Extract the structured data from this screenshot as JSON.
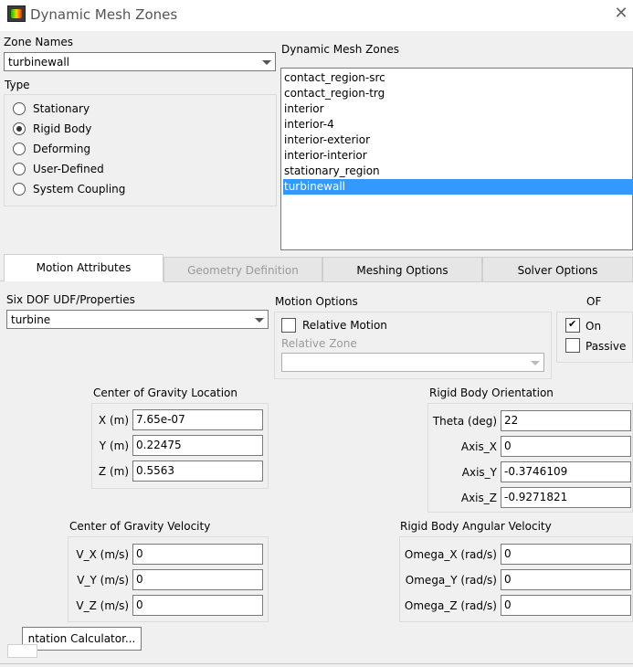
{
  "window": {
    "title": "Dynamic Mesh Zones"
  },
  "zone_names": {
    "label": "Zone Names",
    "value": "turbinewall"
  },
  "type": {
    "label": "Type",
    "options": [
      "Stationary",
      "Rigid Body",
      "Deforming",
      "User-Defined",
      "System Coupling"
    ],
    "selected": "Rigid Body"
  },
  "zones_list": {
    "label": "Dynamic Mesh Zones",
    "items": [
      "contact_region-src",
      "contact_region-trg",
      "interior",
      "interior-4",
      "interior-exterior",
      "interior-interior",
      "stationary_region",
      "turbinewall"
    ],
    "selected": "turbinewall"
  },
  "tabs": [
    "Motion Attributes",
    "Geometry Definition",
    "Meshing Options",
    "Solver Options"
  ],
  "six_dof": {
    "label": "Six DOF UDF/Properties",
    "value": "turbine"
  },
  "motion_options": {
    "label": "Motion Options",
    "relative_motion": "Relative Motion",
    "relative_zone_label": "Relative Zone",
    "relative_zone_value": ""
  },
  "dof": {
    "label": "OF",
    "on": "On",
    "passive": "Passive",
    "on_checked": true,
    "passive_checked": false
  },
  "cog_location": {
    "label": "Center of Gravity Location",
    "x_label": "X (m)",
    "x": "7.65e-07",
    "y_label": "Y (m)",
    "y": "0.22475",
    "z_label": "Z (m)",
    "z": "0.5563"
  },
  "rb_orientation": {
    "label": "Rigid Body Orientation",
    "theta_label": "Theta (deg)",
    "theta": "22",
    "ax_label": "Axis_X",
    "ax": "0",
    "ay_label": "Axis_Y",
    "ay": "-0.3746109",
    "az_label": "Axis_Z",
    "az": "-0.9271821"
  },
  "cog_velocity": {
    "label": "Center of Gravity Velocity",
    "vx_label": "V_X (m/s)",
    "vx": "0",
    "vy_label": "V_Y (m/s)",
    "vy": "0",
    "vz_label": "V_Z (m/s)",
    "vz": "0"
  },
  "rb_angular": {
    "label": "Rigid Body Angular Velocity",
    "wx_label": "Omega_X (rad/s)",
    "wx": "0",
    "wy_label": "Omega_Y (rad/s)",
    "wy": "0",
    "wz_label": "Omega_Z (rad/s)",
    "wz": "0"
  },
  "orientation_calc": {
    "label": "ntation Calculator..."
  }
}
